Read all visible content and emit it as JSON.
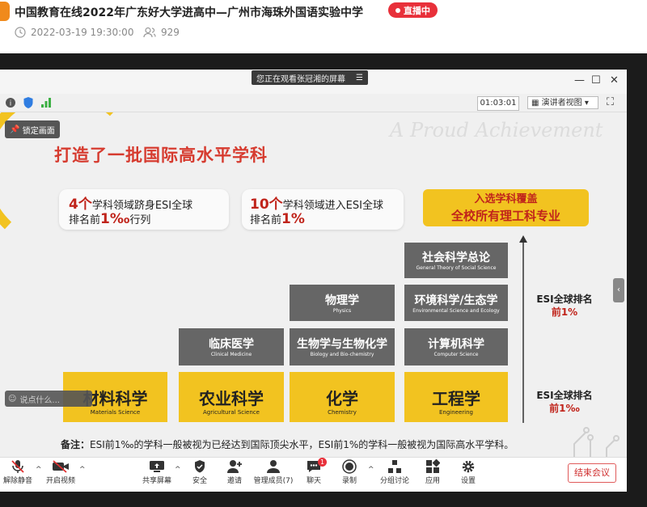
{
  "header": {
    "title": "中国教育在线2022年广东好大学进高中—广州市海珠外国语实验中学",
    "live_label": "直播中",
    "datetime": "2022-03-19 19:30:00",
    "viewers": "929"
  },
  "meeting": {
    "share_notice": "您正在观看张冠湘的屏幕",
    "timer": "01:03:01",
    "view_mode": "演讲者视图",
    "lock_label": "锁定画面",
    "chat_placeholder": "说点什么..."
  },
  "slide": {
    "watermark": "A Proud Achievement",
    "title": "打造了一批国际高水平学科",
    "card1": {
      "num": "4个",
      "line1": "学科领域跻身ESI全球",
      "line2_pre": "排名前",
      "line2_num": "1‰",
      "line2_post": "行列"
    },
    "card2": {
      "num": "10个",
      "line1": "学科领域进入ESI全球",
      "line2_pre": "排名前",
      "line2_num": "1%"
    },
    "card3": {
      "line1": "入选学科覆盖",
      "line2": "全校所有理工科专业"
    },
    "rank_top": {
      "line1": "ESI全球排名",
      "line2": "前1%"
    },
    "rank_bottom": {
      "line1": "ESI全球排名",
      "line2": "前1‰"
    },
    "gray_boxes": [
      {
        "cn": "社会科学总论",
        "en": "General Theory of Social Science"
      },
      {
        "cn": "物理学",
        "en": "Physics"
      },
      {
        "cn": "环境科学/生态学",
        "en": "Environmental Science and Ecology"
      },
      {
        "cn": "临床医学",
        "en": "Clinical Medicine"
      },
      {
        "cn": "生物学与生物化学",
        "en": "Biology and Bio-chemistry"
      },
      {
        "cn": "计算机科学",
        "en": "Computer Science"
      }
    ],
    "yellow_boxes": [
      {
        "cn": "材料科学",
        "en": "Materials Science"
      },
      {
        "cn": "农业科学",
        "en": "Agricultural Science"
      },
      {
        "cn": "化学",
        "en": "Chemistry"
      },
      {
        "cn": "工程学",
        "en": "Engineering"
      }
    ],
    "note_label": "备注：",
    "note_text": "ESI前1‰的学科一般被视为已经达到国际顶尖水平，ESI前1%的学科一般被视为国际高水平学科。"
  },
  "toolbar": {
    "items": [
      {
        "label": "解除静音",
        "icon": "mic-muted-icon"
      },
      {
        "label": "开启视频",
        "icon": "video-off-icon"
      },
      {
        "label": "共享屏幕",
        "icon": "share-screen-icon"
      },
      {
        "label": "安全",
        "icon": "shield-icon"
      },
      {
        "label": "邀请",
        "icon": "add-user-icon"
      },
      {
        "label": "管理成员(7)",
        "icon": "members-icon"
      },
      {
        "label": "聊天",
        "icon": "chat-icon",
        "badge": "1"
      },
      {
        "label": "录制",
        "icon": "record-icon"
      },
      {
        "label": "分组讨论",
        "icon": "breakout-icon"
      },
      {
        "label": "应用",
        "icon": "apps-icon"
      },
      {
        "label": "设置",
        "icon": "gear-icon"
      }
    ],
    "end_label": "结束会议"
  },
  "colors": {
    "accent_red": "#d63b2f",
    "yellow": "#f2c320",
    "gray_box": "#666666",
    "live_red": "#e8303a"
  }
}
